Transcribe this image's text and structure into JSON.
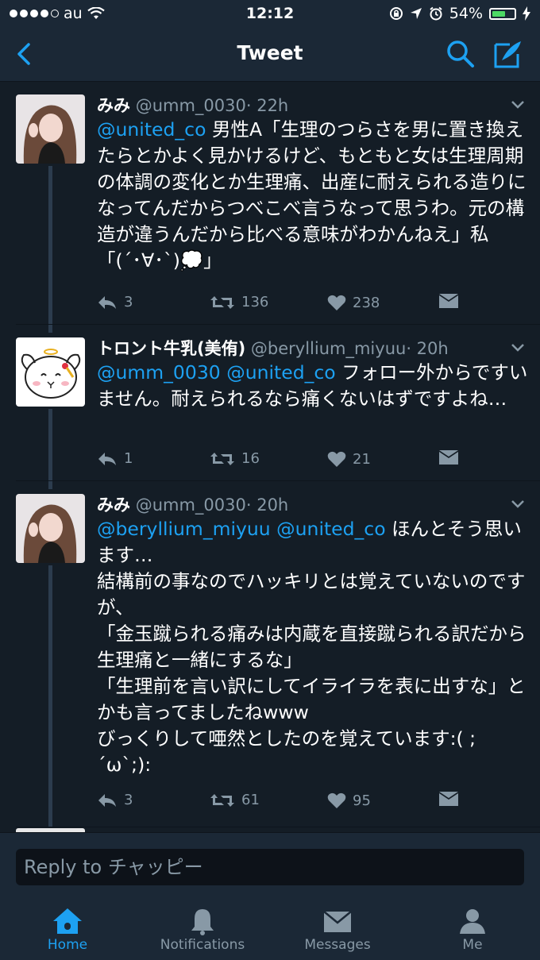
{
  "status_bar": {
    "carrier": "au",
    "time": "12:12",
    "battery": "54%",
    "battery_level": 0.54
  },
  "navbar": {
    "title": "Tweet",
    "back_icon": "chevron-left-icon",
    "search_icon": "search-icon",
    "compose_icon": "compose-icon"
  },
  "tweets": [
    {
      "name": "みみ",
      "handle": "@umm_0030",
      "time": "· 22h",
      "mentions": "@united_co",
      "text": " 男性A「生理のつらさを男に置き換えたらとかよく見かけるけど、もともと女は生理周期の体調の変化とか生理痛、出産に耐えられる造りになってんだからつべこべ言うなって思うわ。元の構造が違うんだから比べる意味がわかんねえ」私「(´･∀･`)💭」",
      "replies": "3",
      "retweets": "136",
      "likes": "238"
    },
    {
      "name": "トロント牛乳(美侑)",
      "handle": "@beryllium_miyuu",
      "time": "· 20h",
      "mentions": "@umm_0030 @united_co",
      "text": " フォロー外からですいません。耐えられるなら痛くないはずですよね…",
      "replies": "1",
      "retweets": "16",
      "likes": "21"
    },
    {
      "name": "みみ",
      "handle": "@umm_0030",
      "time": "· 20h",
      "mentions": "@beryllium_miyuu @united_co",
      "text": " ほんとそう思います…\n結構前の事なのでハッキリとは覚えていないのですが、\n「金玉蹴られる痛みは内蔵を直接蹴られる訳だから生理痛と一緒にするな」\n「生理前を言い訳にしてイライラを表に出すな」とかも言ってましたねwww\nびっくりして唖然としたのを覚えています:( ; ´ω`;):",
      "replies": "3",
      "retweets": "61",
      "likes": "95"
    }
  ],
  "reply": {
    "placeholder": "Reply to チャッピー"
  },
  "tabs": [
    {
      "label": "Home",
      "icon": "home-icon",
      "active": true
    },
    {
      "label": "Notifications",
      "icon": "bell-icon",
      "active": false
    },
    {
      "label": "Messages",
      "icon": "envelope-icon",
      "active": false
    },
    {
      "label": "Me",
      "icon": "person-icon",
      "active": false
    }
  ],
  "colors": {
    "background": "#141d26",
    "bar": "#1b2836",
    "accent": "#1da1f2",
    "muted": "#8899a6"
  }
}
